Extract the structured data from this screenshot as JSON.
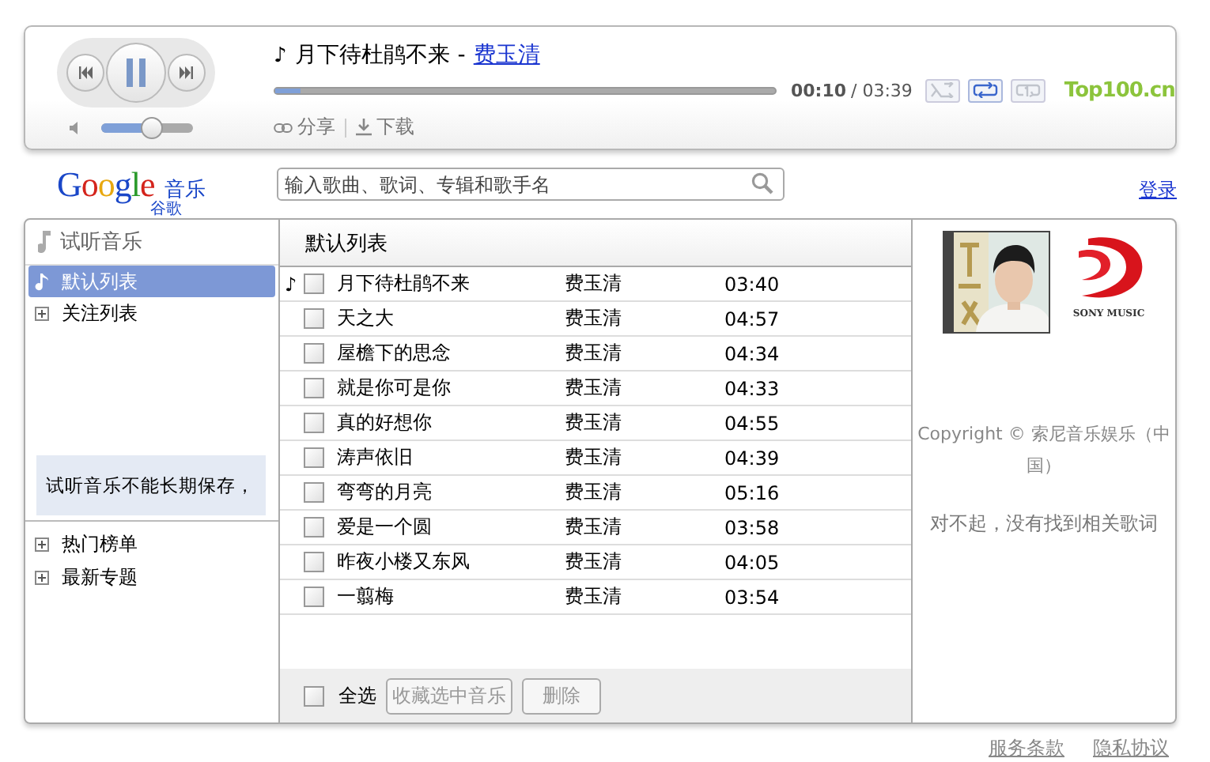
{
  "player": {
    "playing": true,
    "note_icon": "♪",
    "title": "月下待杜鹃不来",
    "separator": "-",
    "artist": "费玉清",
    "progress": {
      "level": 0.05
    },
    "volume": {
      "level": 0.55
    },
    "elapsed": "00:10",
    "duration": "/ 03:39",
    "actions": [
      {
        "kind": "share",
        "label": "分享"
      },
      {
        "kind": "download",
        "label": "下载"
      }
    ],
    "modes": [
      {
        "kind": "shuffle",
        "selected": false
      },
      {
        "kind": "repeat",
        "selected": true
      },
      {
        "kind": "repeat-one",
        "selected": false
      }
    ],
    "partner_logo": "Top100.cn"
  },
  "header": {
    "logo": "Google",
    "logo_sub": "谷歌",
    "product": "音乐",
    "search": {
      "placeholder": "输入歌曲、歌词、专辑和歌手名"
    },
    "login": "登录"
  },
  "sidebar": {
    "title": "试听音乐",
    "lists": [
      {
        "label": "默认列表",
        "kind": "playlist",
        "selected": true
      },
      {
        "label": "关注列表",
        "kind": "folder",
        "selected": false
      }
    ],
    "notice": "试听音乐不能长期保存，",
    "sections": [
      {
        "label": "热门榜单",
        "expanded": false
      },
      {
        "label": "最新专题",
        "expanded": false
      }
    ]
  },
  "playlist": {
    "title": "默认列表",
    "playing_icon": "♪",
    "rows": [
      {
        "title": "月下待杜鹃不来",
        "artist": "费玉清",
        "duration": "03:40",
        "checked": false,
        "playing": true
      },
      {
        "title": "天之大",
        "artist": "费玉清",
        "duration": "04:57",
        "checked": false,
        "playing": false
      },
      {
        "title": "屋檐下的思念",
        "artist": "费玉清",
        "duration": "04:34",
        "checked": false,
        "playing": false
      },
      {
        "title": "就是你可是你",
        "artist": "费玉清",
        "duration": "04:33",
        "checked": false,
        "playing": false
      },
      {
        "title": "真的好想你",
        "artist": "费玉清",
        "duration": "04:55",
        "checked": false,
        "playing": false
      },
      {
        "title": "涛声依旧",
        "artist": "费玉清",
        "duration": "04:39",
        "checked": false,
        "playing": false
      },
      {
        "title": "弯弯的月亮",
        "artist": "费玉清",
        "duration": "05:16",
        "checked": false,
        "playing": false
      },
      {
        "title": "爱是一个圆",
        "artist": "费玉清",
        "duration": "03:58",
        "checked": false,
        "playing": false
      },
      {
        "title": "昨夜小楼又东风",
        "artist": "费玉清",
        "duration": "04:05",
        "checked": false,
        "playing": false
      },
      {
        "title": "一翦梅",
        "artist": "费玉清",
        "duration": "03:54",
        "checked": false,
        "playing": false
      }
    ],
    "select_all": {
      "label": "全选",
      "checked": false
    },
    "buttons": [
      {
        "label": "收藏选中音乐",
        "disabled": true
      },
      {
        "label": "删除",
        "disabled": true
      }
    ]
  },
  "info": {
    "label_logo": "SONY MUSIC",
    "copyright": "Copyright © 索尼音乐娱乐（中国）",
    "lyrics_message": "对不起，没有找到相关歌词"
  },
  "footer_links": [
    "服务条款",
    "隐私协议"
  ]
}
